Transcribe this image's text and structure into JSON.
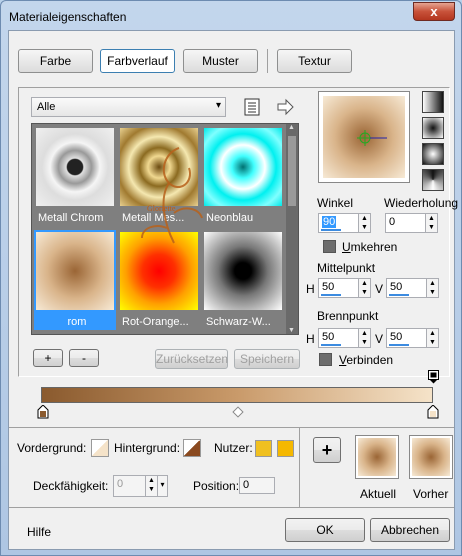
{
  "window": {
    "title": "Materialeigenschaften",
    "close_glyph": "x"
  },
  "tabs": [
    {
      "label": "Farbe"
    },
    {
      "label": "Farbverlauf"
    },
    {
      "label": "Muster"
    },
    {
      "label": "Textur"
    }
  ],
  "category": {
    "value": "Alle"
  },
  "gradients": [
    {
      "label": "Metall Chrom"
    },
    {
      "label": "Metall Mes..."
    },
    {
      "label": "Neonblau"
    },
    {
      "label": "rom"
    },
    {
      "label": "Rot-Orange..."
    },
    {
      "label": "Schwarz-W..."
    }
  ],
  "buttons": {
    "add": "+",
    "remove": "-",
    "reset": "Zurücksetzen",
    "save": "Speichern",
    "help": "Hilfe",
    "ok": "OK",
    "cancel": "Abbrechen",
    "plus": "+"
  },
  "angle": {
    "label": "Winkel",
    "value": "90"
  },
  "repeat": {
    "label": "Wiederholung",
    "value": "0"
  },
  "invert": {
    "label": "Umkehren",
    "underline": "U",
    "rest": "mkehren"
  },
  "center": {
    "label": "Mittelpunkt",
    "h_label": "H",
    "h": "50",
    "v_label": "V",
    "v": "50"
  },
  "focus": {
    "label": "Brennpunkt",
    "h_label": "H",
    "h": "50",
    "v_label": "V",
    "v": "50"
  },
  "link": {
    "label": "Verbinden",
    "underline": "V",
    "rest": "erbinden"
  },
  "bottom": {
    "fg_label": "Vordergrund:",
    "bg_label": "Hintergrund:",
    "user_label": "Nutzer:",
    "opacity_label": "Deckfähigkeit:",
    "opacity_value": "0",
    "position_label": "Position:",
    "position_value": "0",
    "current_label": "Aktuell",
    "previous_label": "Vorher"
  },
  "colors": {
    "accent": "#3399ff",
    "gradient_start": "#8a5a2e",
    "gradient_end": "#f5e3c9",
    "user1": "#f0c020",
    "user2": "#f5b800"
  },
  "icons": {
    "list_view": "list-view-icon",
    "arrow": "arrow-right-icon",
    "scroll_up": "▲",
    "scroll_down": "▼",
    "dropdown": "▾",
    "spin_up": "▲",
    "spin_down": "▼"
  }
}
